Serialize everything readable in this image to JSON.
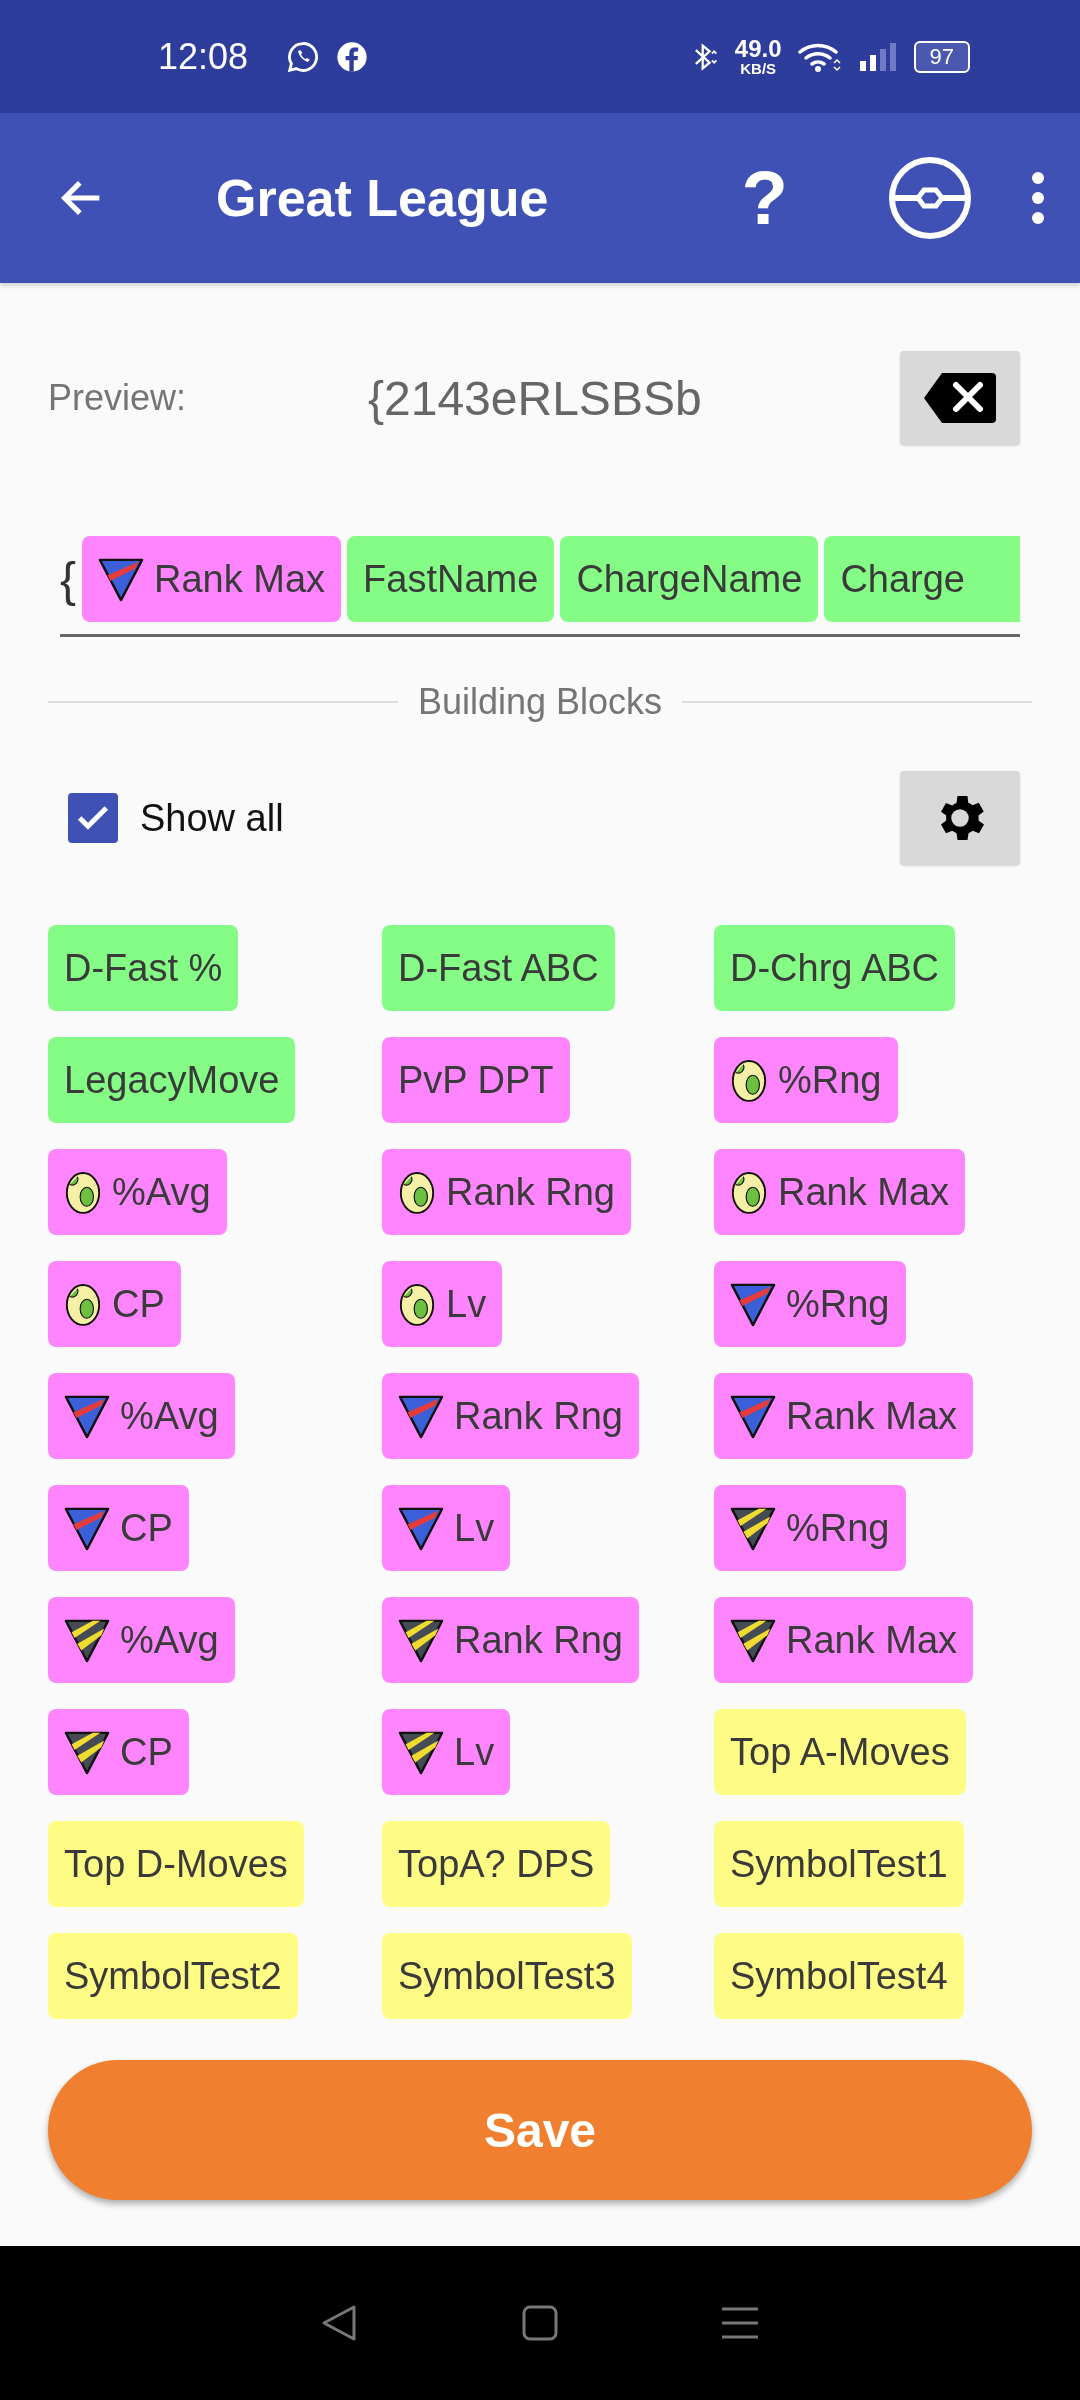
{
  "status_bar": {
    "time": "12:08",
    "net_speed": "49.0",
    "net_unit": "KB/S",
    "battery": "97"
  },
  "app_bar": {
    "title": "Great League",
    "help": "?"
  },
  "preview": {
    "label": "Preview:",
    "value": "{2143eRLSBSb"
  },
  "formula": {
    "prefix": "{",
    "chips": [
      {
        "label": "Rank Max",
        "color": "#ff85ff",
        "kind": "triangle"
      },
      {
        "label": "FastName",
        "color": "#85fc85",
        "kind": "plain"
      },
      {
        "label": "ChargeName",
        "color": "#85fc85",
        "kind": "plain"
      },
      {
        "label": "Charge",
        "color": "#85fc85",
        "kind": "plain"
      }
    ]
  },
  "section_title": "Building Blocks",
  "show_all": {
    "label": "Show all",
    "checked": true
  },
  "blocks": [
    {
      "label": "D-Fast %",
      "color": "#85fc85",
      "kind": "plain"
    },
    {
      "label": "D-Fast ABC",
      "color": "#85fc85",
      "kind": "plain"
    },
    {
      "label": "D-Chrg ABC",
      "color": "#85fc85",
      "kind": "plain"
    },
    {
      "label": "LegacyMove",
      "color": "#85fc85",
      "kind": "plain"
    },
    {
      "label": "PvP DPT",
      "color": "#ff85ff",
      "kind": "plain"
    },
    {
      "label": "%Rng",
      "color": "#ff85ff",
      "kind": "egg"
    },
    {
      "label": "%Avg",
      "color": "#ff85ff",
      "kind": "egg"
    },
    {
      "label": "Rank Rng",
      "color": "#ff85ff",
      "kind": "egg"
    },
    {
      "label": "Rank Max",
      "color": "#ff85ff",
      "kind": "egg"
    },
    {
      "label": "CP",
      "color": "#ff85ff",
      "kind": "egg"
    },
    {
      "label": "Lv",
      "color": "#ff85ff",
      "kind": "egg"
    },
    {
      "label": "%Rng",
      "color": "#ff85ff",
      "kind": "triangle"
    },
    {
      "label": "%Avg",
      "color": "#ff85ff",
      "kind": "triangle"
    },
    {
      "label": "Rank Rng",
      "color": "#ff85ff",
      "kind": "triangle"
    },
    {
      "label": "Rank Max",
      "color": "#ff85ff",
      "kind": "triangle"
    },
    {
      "label": "CP",
      "color": "#ff85ff",
      "kind": "triangle"
    },
    {
      "label": "Lv",
      "color": "#ff85ff",
      "kind": "triangle"
    },
    {
      "label": "%Rng",
      "color": "#ff85ff",
      "kind": "striped"
    },
    {
      "label": "%Avg",
      "color": "#ff85ff",
      "kind": "striped"
    },
    {
      "label": "Rank Rng",
      "color": "#ff85ff",
      "kind": "striped"
    },
    {
      "label": "Rank Max",
      "color": "#ff85ff",
      "kind": "striped"
    },
    {
      "label": "CP",
      "color": "#ff85ff",
      "kind": "striped"
    },
    {
      "label": "Lv",
      "color": "#ff85ff",
      "kind": "striped"
    },
    {
      "label": "Top A-Moves",
      "color": "#fffc85",
      "kind": "plain"
    },
    {
      "label": "Top D-Moves",
      "color": "#fffc85",
      "kind": "plain"
    },
    {
      "label": "TopA? DPS",
      "color": "#fffc85",
      "kind": "plain"
    },
    {
      "label": "SymbolTest1",
      "color": "#fffc85",
      "kind": "plain"
    },
    {
      "label": "SymbolTest2",
      "color": "#fffc85",
      "kind": "plain"
    },
    {
      "label": "SymbolTest3",
      "color": "#fffc85",
      "kind": "plain"
    },
    {
      "label": "SymbolTest4",
      "color": "#fffc85",
      "kind": "plain"
    }
  ],
  "save_button": "Save"
}
